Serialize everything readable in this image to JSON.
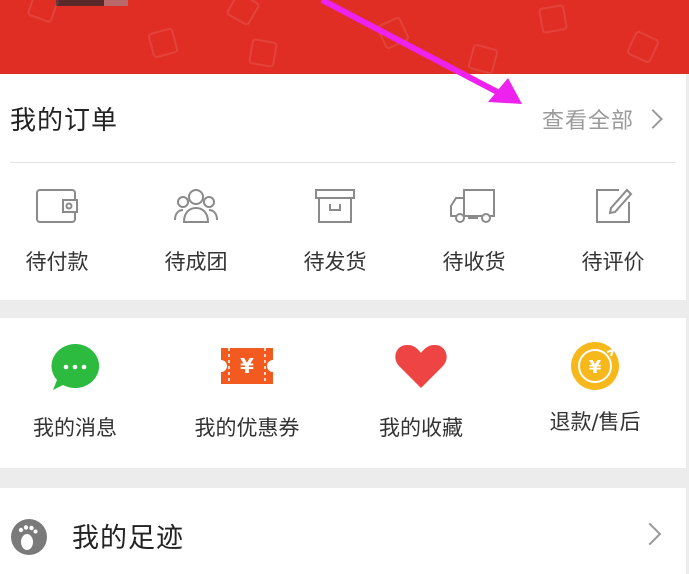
{
  "orders": {
    "title": "我的订单",
    "view_all_label": "查看全部",
    "items": [
      {
        "label": "待付款",
        "icon": "wallet-icon"
      },
      {
        "label": "待成团",
        "icon": "group-icon"
      },
      {
        "label": "待发货",
        "icon": "package-icon"
      },
      {
        "label": "待收货",
        "icon": "truck-icon"
      },
      {
        "label": "待评价",
        "icon": "edit-icon"
      }
    ]
  },
  "services": {
    "items": [
      {
        "label": "我的消息",
        "icon": "message-icon"
      },
      {
        "label": "我的优惠券",
        "icon": "coupon-icon"
      },
      {
        "label": "我的收藏",
        "icon": "heart-icon"
      },
      {
        "label": "退款/售后",
        "icon": "refund-icon"
      }
    ],
    "coupon_symbol": "¥",
    "refund_symbol": "¥",
    "message_symbol": "···"
  },
  "footprint": {
    "label": "我的足迹",
    "icon": "footprint-icon"
  },
  "colors": {
    "banner": "#e02e24",
    "message_green": "#2dbb3f",
    "coupon_orange": "#f35a1f",
    "heart_red": "#ef4444",
    "refund_yellow": "#f6b81a",
    "annotation_arrow": "#ee22ee"
  }
}
